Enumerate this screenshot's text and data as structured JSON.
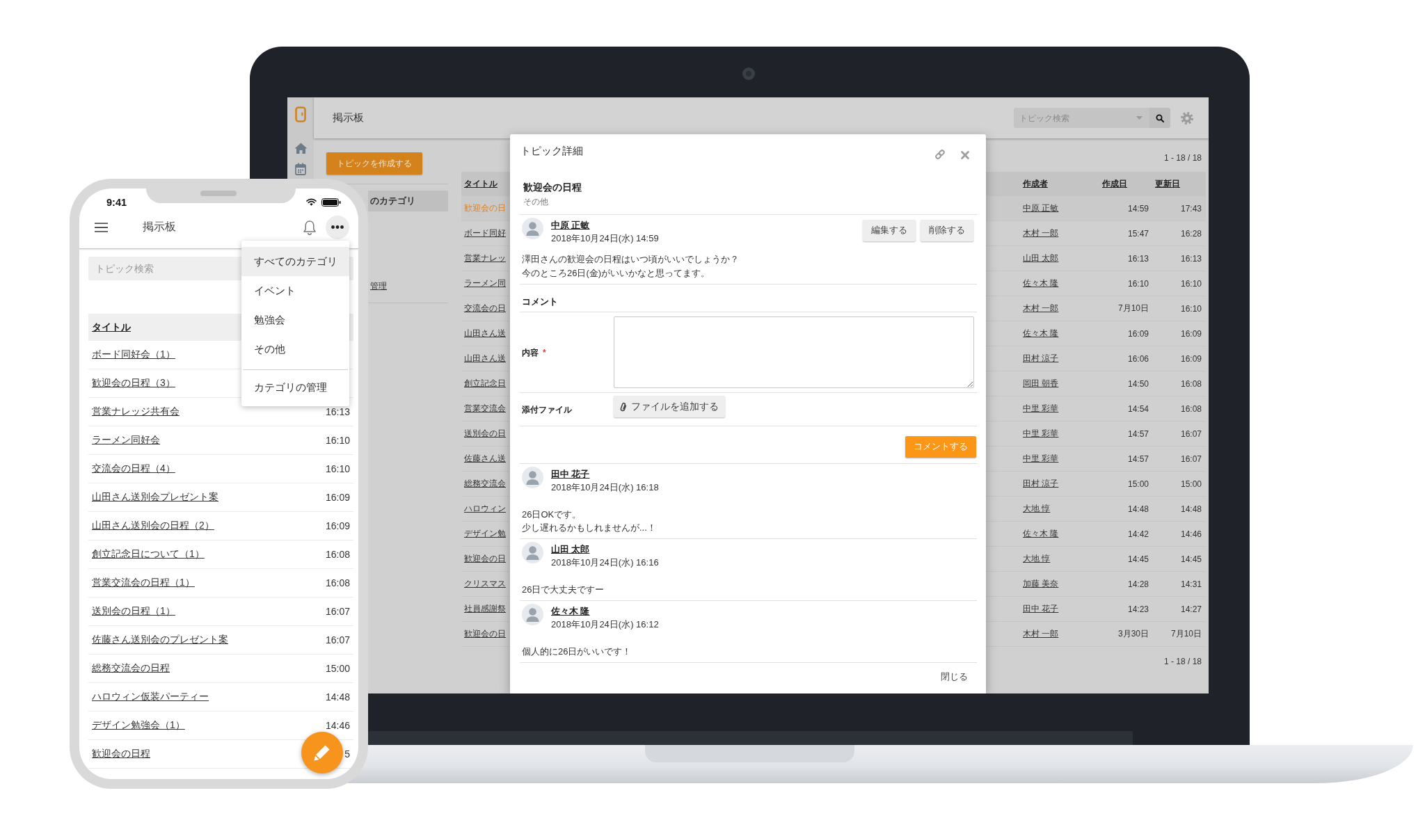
{
  "laptop": {
    "app_bar": {
      "title": "掲示板",
      "search": {
        "placeholder": "トピック検索"
      }
    },
    "create_button": "トピックを作成する",
    "categories": [
      {
        "label": "のカテゴリ",
        "selected": true
      }
    ],
    "manage_link": "管理",
    "pagination_top": "1 - 18 / 18",
    "table": {
      "columns": [
        "タイトル",
        "作成者",
        "作成日",
        "更新日"
      ],
      "rows": [
        {
          "title": "歓迎会の日",
          "author": "中原 正敏",
          "created": "14:59",
          "updated": "17:43",
          "selected": true
        },
        {
          "title": "ボード同好",
          "author": "木村 一郎",
          "created": "15:47",
          "updated": "16:28",
          "selected": false
        },
        {
          "title": "営業ナレッ",
          "author": "山田 太郎",
          "created": "16:13",
          "updated": "16:13",
          "selected": false
        },
        {
          "title": "ラーメン同",
          "author": "佐々木 隆",
          "created": "16:10",
          "updated": "16:10",
          "selected": false
        },
        {
          "title": "交流会の日",
          "author": "木村 一郎",
          "created": "7月10日",
          "updated": "16:10",
          "selected": false
        },
        {
          "title": "山田さん送",
          "author": "佐々木 隆",
          "created": "16:09",
          "updated": "16:09",
          "selected": false
        },
        {
          "title": "山田さん送",
          "author": "田村 涼子",
          "created": "16:06",
          "updated": "16:09",
          "selected": false
        },
        {
          "title": "創立記念日",
          "author": "岡田 朝香",
          "created": "14:50",
          "updated": "16:08",
          "selected": false
        },
        {
          "title": "営業交流会",
          "author": "中里 彩華",
          "created": "14:54",
          "updated": "16:08",
          "selected": false
        },
        {
          "title": "送別会の日",
          "author": "中里 彩華",
          "created": "14:57",
          "updated": "16:07",
          "selected": false
        },
        {
          "title": "佐藤さん送",
          "author": "中里 彩華",
          "created": "14:57",
          "updated": "16:07",
          "selected": false
        },
        {
          "title": "総務交流会",
          "author": "田村 涼子",
          "created": "15:00",
          "updated": "15:00",
          "selected": false
        },
        {
          "title": "ハロウィン",
          "author": "大地 惇",
          "created": "14:48",
          "updated": "14:48",
          "selected": false
        },
        {
          "title": "デザイン勉",
          "author": "佐々木 隆",
          "created": "14:42",
          "updated": "14:46",
          "selected": false
        },
        {
          "title": "歓迎会の日",
          "author": "大地 惇",
          "created": "14:45",
          "updated": "14:45",
          "selected": false
        },
        {
          "title": "クリスマス",
          "author": "加藤 美奈",
          "created": "14:28",
          "updated": "14:31",
          "selected": false
        },
        {
          "title": "社員感謝祭",
          "author": "田中 花子",
          "created": "14:23",
          "updated": "14:27",
          "selected": false
        },
        {
          "title": "歓迎会の日",
          "author": "木村 一郎",
          "created": "3月30日",
          "updated": "7月10日",
          "selected": false
        }
      ]
    },
    "pagination_bottom": "1 - 18 / 18"
  },
  "modal": {
    "title": "トピック詳細",
    "topic": {
      "title": "歓迎会の日程",
      "category": "その他",
      "author": "中原 正敏",
      "date": "2018年10月24日(水) 14:59",
      "actions": [
        "編集する",
        "削除する"
      ],
      "body": [
        "澤田さんの歓迎会の日程はいつ頃がいいでしょうか？",
        "今のところ26日(金)がいいかなと思ってます。"
      ]
    },
    "comment_heading": "コメント",
    "form": {
      "content_label": "内容",
      "required_mark": "*",
      "attachment_label": "添付ファイル",
      "attach_button": "ファイルを追加する",
      "submit_button": "コメントする"
    },
    "comments": [
      {
        "author": "田中 花子",
        "date": "2018年10月24日(水) 16:18",
        "body": [
          "26日OKです。",
          "少し遅れるかもしれませんが...！"
        ]
      },
      {
        "author": "山田 太郎",
        "date": "2018年10月24日(水) 16:16",
        "body": [
          "26日で大丈夫ですー"
        ]
      },
      {
        "author": "佐々木 隆",
        "date": "2018年10月24日(水) 16:12",
        "body": [
          "個人的に26日がいいです！"
        ]
      }
    ],
    "close_button": "閉じる"
  },
  "phone": {
    "status_time": "9:41",
    "title": "掲示板",
    "search": {
      "placeholder": "トピック検索"
    },
    "table": {
      "column": "タイトル",
      "rows": [
        {
          "title": "ボード同好会（1）"
        },
        {
          "title": "歓迎会の日程（3）"
        },
        {
          "title": "営業ナレッジ共有会",
          "time": "16:13"
        },
        {
          "title": "ラーメン同好会",
          "time": "16:10"
        },
        {
          "title": "交流会の日程（4）",
          "time": "16:10"
        },
        {
          "title": "山田さん送別会プレゼント案",
          "time": "16:09"
        },
        {
          "title": "山田さん送別会の日程（2）",
          "time": "16:09"
        },
        {
          "title": "創立記念日について（1）",
          "time": "16:08"
        },
        {
          "title": "営業交流会の日程（1）",
          "time": "16:08"
        },
        {
          "title": "送別会の日程（1）",
          "time": "16:07"
        },
        {
          "title": "佐藤さん送別会のプレゼント案",
          "time": "16:07"
        },
        {
          "title": "総務交流会の日程",
          "time": "15:00"
        },
        {
          "title": "ハロウィン仮装パーティー",
          "time": "14:48"
        },
        {
          "title": "デザイン勉強会（1）",
          "time": "14:46"
        },
        {
          "title": "歓迎会の日程",
          "time": "5"
        }
      ]
    },
    "menu": {
      "items": [
        {
          "label": "すべてのカテゴリ",
          "selected": true
        },
        {
          "label": "イベント",
          "selected": false
        },
        {
          "label": "勉強会",
          "selected": false
        },
        {
          "label": "その他",
          "selected": false
        }
      ],
      "manage": "カテゴリの管理"
    }
  }
}
